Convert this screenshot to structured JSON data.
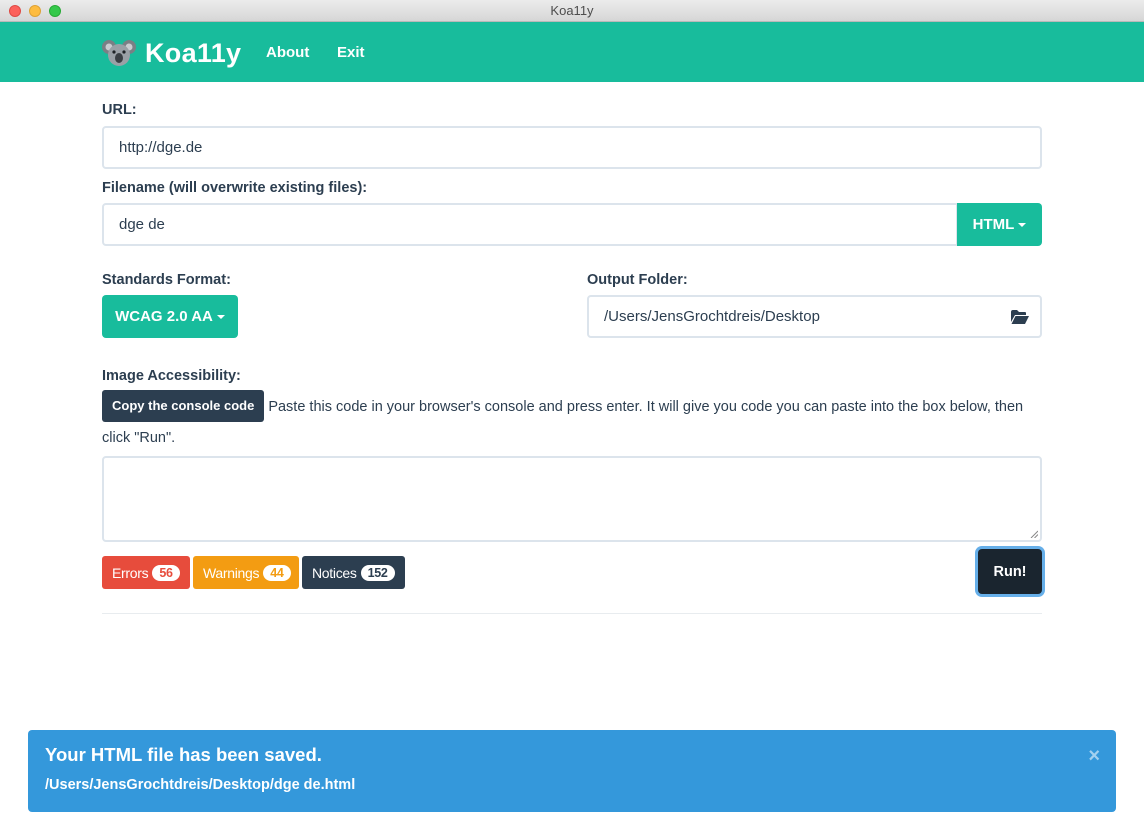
{
  "window": {
    "title": "Koa11y"
  },
  "nav": {
    "brand": "Koa11y",
    "about": "About",
    "exit": "Exit"
  },
  "form": {
    "url_label": "URL:",
    "url_value": "http://dge.de",
    "filename_label": "Filename (will overwrite existing files):",
    "filename_value": "dge de",
    "format_button": "HTML",
    "standards_label": "Standards Format:",
    "standards_button": "WCAG 2.0 AA",
    "output_label": "Output Folder:",
    "output_value": "/Users/JensGrochtdreis/Desktop",
    "image_label": "Image Accessibility:",
    "copy_button": "Copy the console code",
    "help_text": "Paste this code in your browser's console and press enter. It will give you code you can paste into the box below, then click \"Run\".",
    "textarea_value": ""
  },
  "results": {
    "errors_label": "Errors",
    "errors_count": "56",
    "warnings_label": "Warnings",
    "warnings_count": "44",
    "notices_label": "Notices",
    "notices_count": "152",
    "run_button": "Run!"
  },
  "alert": {
    "title": "Your HTML file has been saved.",
    "path": "/Users/JensGrochtdreis/Desktop/dge de.html",
    "close": "×"
  },
  "colors": {
    "navbar": "#18bc9c",
    "primary_dark": "#2c3e50",
    "danger": "#e74c3c",
    "warning": "#f39c12",
    "info": "#3498db"
  },
  "icons": {
    "logo": "koala-logo-icon",
    "folder": "folder-open-icon",
    "close": "close-icon"
  }
}
